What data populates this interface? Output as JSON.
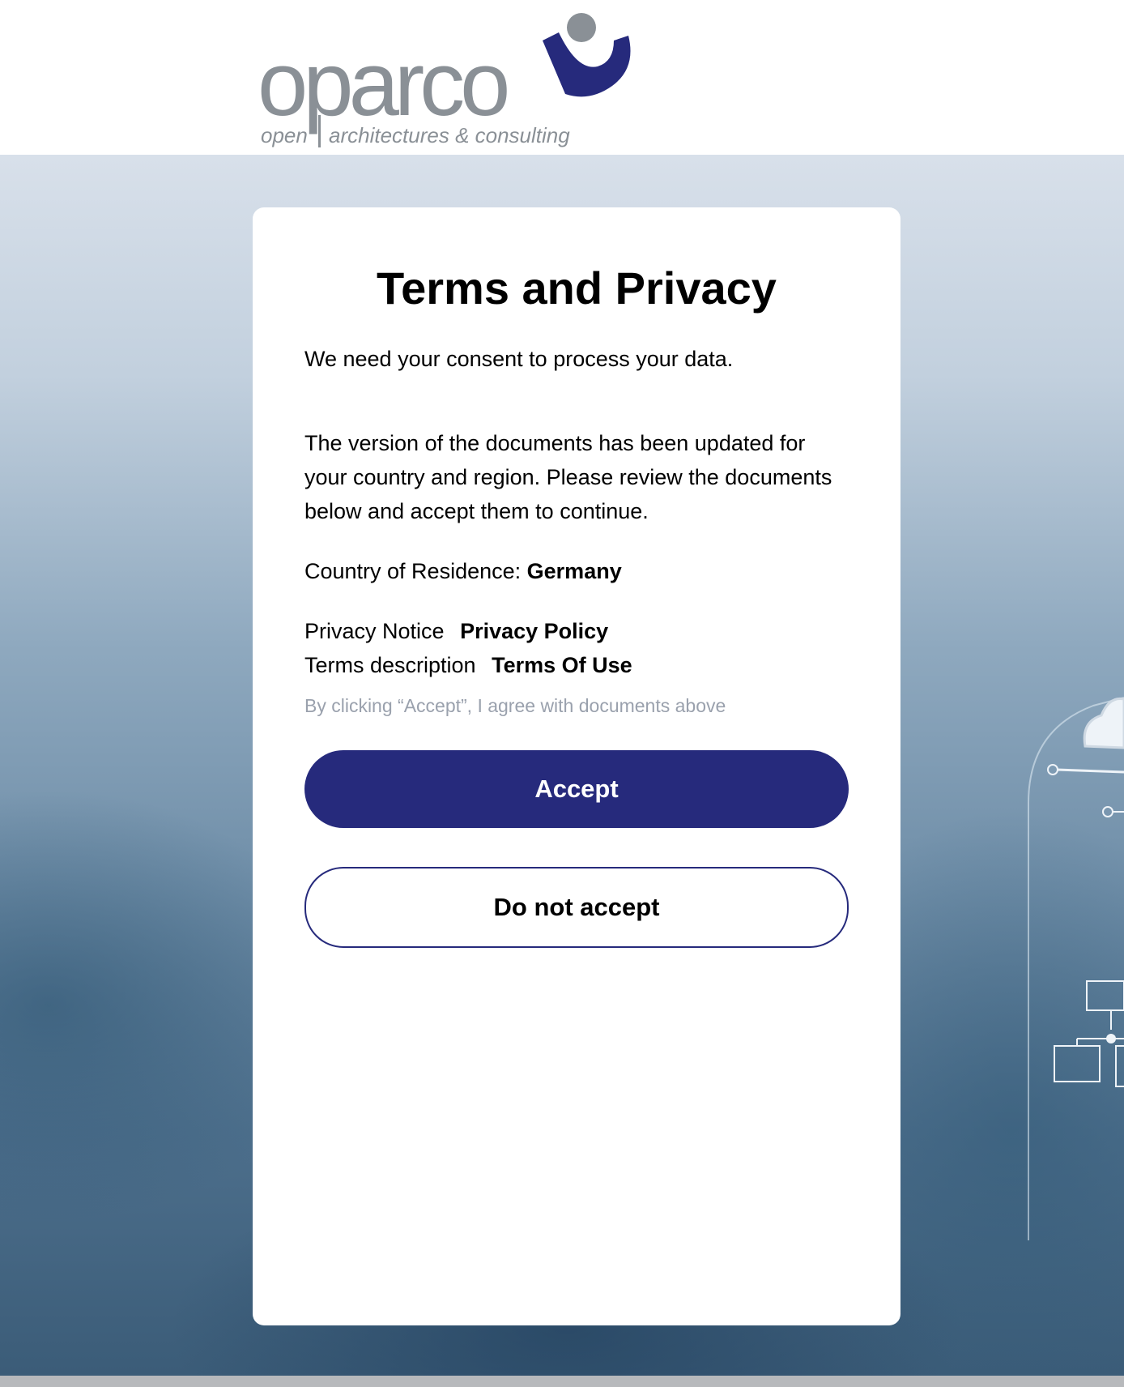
{
  "brand": {
    "name": "oparco",
    "tagline_open": "open",
    "tagline_rest": "architectures & consulting",
    "colors": {
      "accent": "#262a7c",
      "logo_grey": "#8a9096"
    }
  },
  "consent": {
    "title": "Terms and Privacy",
    "intro": "We need your consent to process your data.",
    "version_notice": "The version of the documents has been updated for your country and region. Please review the documents below and accept them to continue.",
    "country_label": "Country of Residence:",
    "country_value": "Germany",
    "documents": [
      {
        "description": "Privacy Notice",
        "link_label": "Privacy Policy"
      },
      {
        "description": "Terms description",
        "link_label": "Terms Of Use"
      }
    ],
    "agreement_note": "By clicking “Accept”, I agree with documents above",
    "accept_label": "Accept",
    "decline_label": "Do not accept"
  }
}
